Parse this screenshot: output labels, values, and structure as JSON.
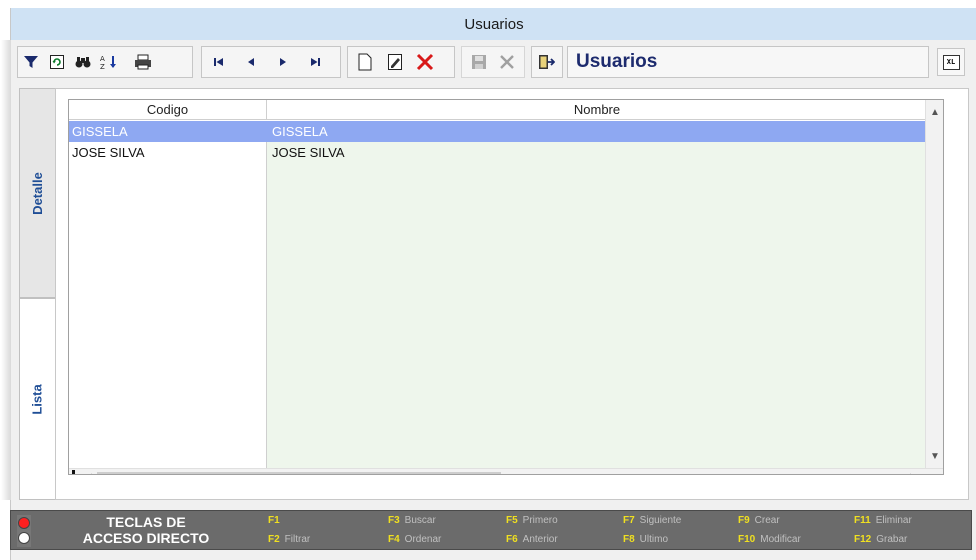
{
  "window": {
    "title": "Usuarios"
  },
  "toolbar": {
    "icons": [
      "filter-icon",
      "refresh-icon",
      "find-icon",
      "sort-icon",
      "print-icon",
      "first-record-icon",
      "previous-record-icon",
      "next-record-icon",
      "last-record-icon",
      "new-document-icon",
      "edit-document-icon",
      "delete-icon",
      "save-icon",
      "cancel-icon",
      "exit-icon",
      "export-xls-icon"
    ],
    "form_title": "Usuarios",
    "xls_label": "XL"
  },
  "tabs": [
    {
      "label": "Detalle",
      "active": false
    },
    {
      "label": "Lista",
      "active": true
    }
  ],
  "grid": {
    "columns": [
      "Codigo",
      "Nombre"
    ],
    "rows": [
      {
        "codigo": "GISSELA",
        "nombre": "GISSELA",
        "selected": true
      },
      {
        "codigo": "JOSE SILVA",
        "nombre": "JOSE SILVA",
        "selected": false
      }
    ]
  },
  "footer": {
    "title_line1": "TECLAS DE",
    "title_line2": "ACCESO DIRECTO",
    "shortcuts": [
      {
        "key": "F1",
        "label": ""
      },
      {
        "key": "F2",
        "label": "Filtrar"
      },
      {
        "key": "F3",
        "label": "Buscar"
      },
      {
        "key": "F4",
        "label": "Ordenar"
      },
      {
        "key": "F5",
        "label": "Primero"
      },
      {
        "key": "F6",
        "label": "Anterior"
      },
      {
        "key": "F7",
        "label": "Siguiente"
      },
      {
        "key": "F8",
        "label": "Ultimo"
      },
      {
        "key": "F9",
        "label": "Crear"
      },
      {
        "key": "F10",
        "label": "Modificar"
      },
      {
        "key": "F11",
        "label": "Eliminar"
      },
      {
        "key": "F12",
        "label": "Grabar"
      }
    ]
  },
  "colors": {
    "title_bar": "#cfe2f4",
    "selected_row": "#8ea8f2",
    "nombre_column": "#eef6ec",
    "form_title_text": "#1d2b6e",
    "tab_text": "#1f4e96",
    "footer_bg": "#6b6b6b",
    "shortcut_key": "#f0e020"
  }
}
